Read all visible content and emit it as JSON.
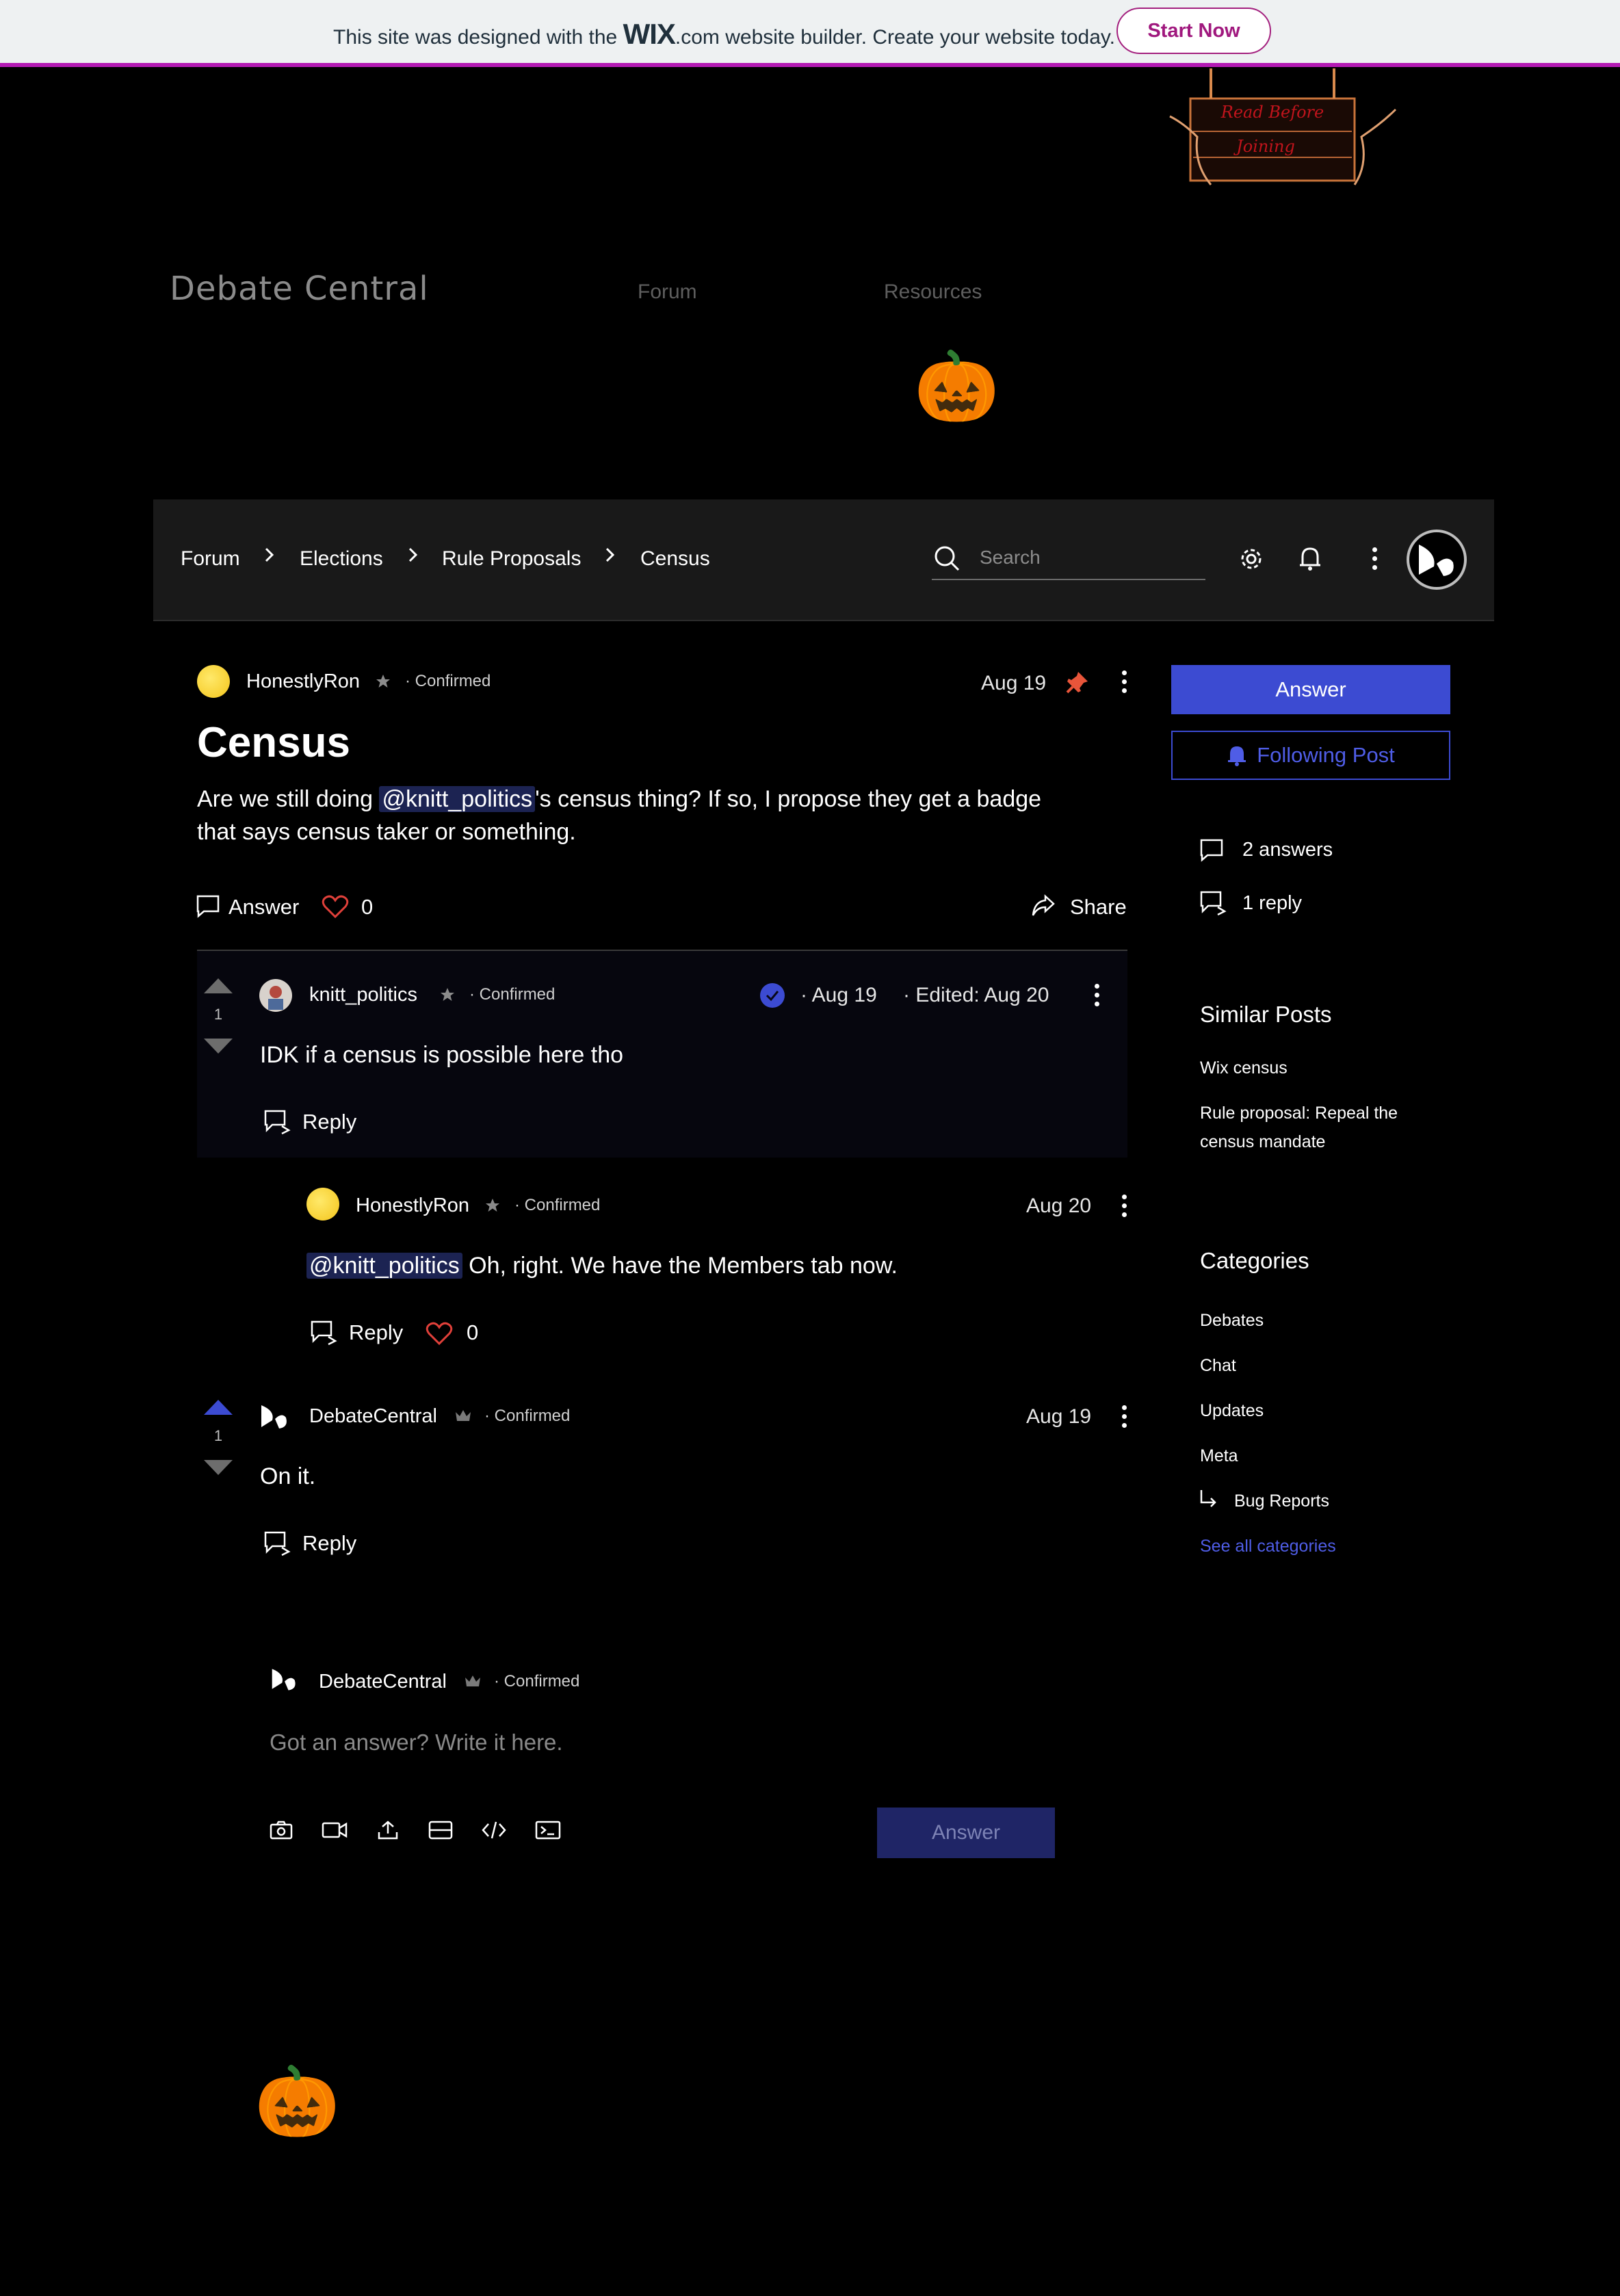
{
  "banner": {
    "text_before": "This site was designed with the ",
    "brand": "WIX",
    "text_after": ".com website builder. Create your website today.",
    "cta": "Start Now"
  },
  "header": {
    "site_title": "Debate Central",
    "nav": [
      "Forum",
      "Resources"
    ],
    "sign_text": [
      "Read Before",
      "Joining"
    ]
  },
  "forum_bar": {
    "breadcrumbs": [
      "Forum",
      "Elections",
      "Rule Proposals",
      "Census"
    ],
    "search_placeholder": "Search"
  },
  "post": {
    "author": "HonestlyRon",
    "badge": "Confirmed",
    "date": "Aug 19",
    "title": "Census",
    "body_before": "Are we still doing ",
    "mention": "@knitt_politics",
    "body_line1_after": "'s census thing? If so, I propose they get a badge",
    "body_line2": "that says census taker or something.",
    "answer_label": "Answer",
    "like_count": "0",
    "share_label": "Share"
  },
  "answers": [
    {
      "author": "knitt_politics",
      "badge": "Confirmed",
      "votes": "1",
      "date": "Aug 19",
      "edited": "Edited: Aug 20",
      "text": "IDK if a census is possible here tho",
      "reply_label": "Reply"
    },
    {
      "author": "DebateCentral",
      "badge": "Confirmed",
      "votes": "1",
      "date": "Aug 19",
      "text": "On it.",
      "reply_label": "Reply"
    }
  ],
  "reply": {
    "author": "HonestlyRon",
    "badge": "Confirmed",
    "date": "Aug 20",
    "mention": "@knitt_politics",
    "text": " Oh, right. We have the Members tab now.",
    "reply_label": "Reply",
    "like_count": "0"
  },
  "composer": {
    "author": "DebateCentral",
    "badge": "Confirmed",
    "placeholder": "Got an answer? Write it here.",
    "submit": "Answer"
  },
  "sidebar": {
    "answer_button": "Answer",
    "following_button": "Following Post",
    "answers_count": "2 answers",
    "replies_count": "1 reply",
    "similar_title": "Similar Posts",
    "similar": [
      "Wix census",
      "Rule proposal: Repeal the",
      "census mandate"
    ],
    "categories_title": "Categories",
    "categories": [
      "Debates",
      "Chat",
      "Updates",
      "Meta",
      "Bug Reports"
    ],
    "see_all": "See all categories"
  },
  "colors": {
    "accent": "#3c4bd2",
    "banner_border": "#b41ab4",
    "like": "#e0403a",
    "pin": "#e8553a"
  }
}
